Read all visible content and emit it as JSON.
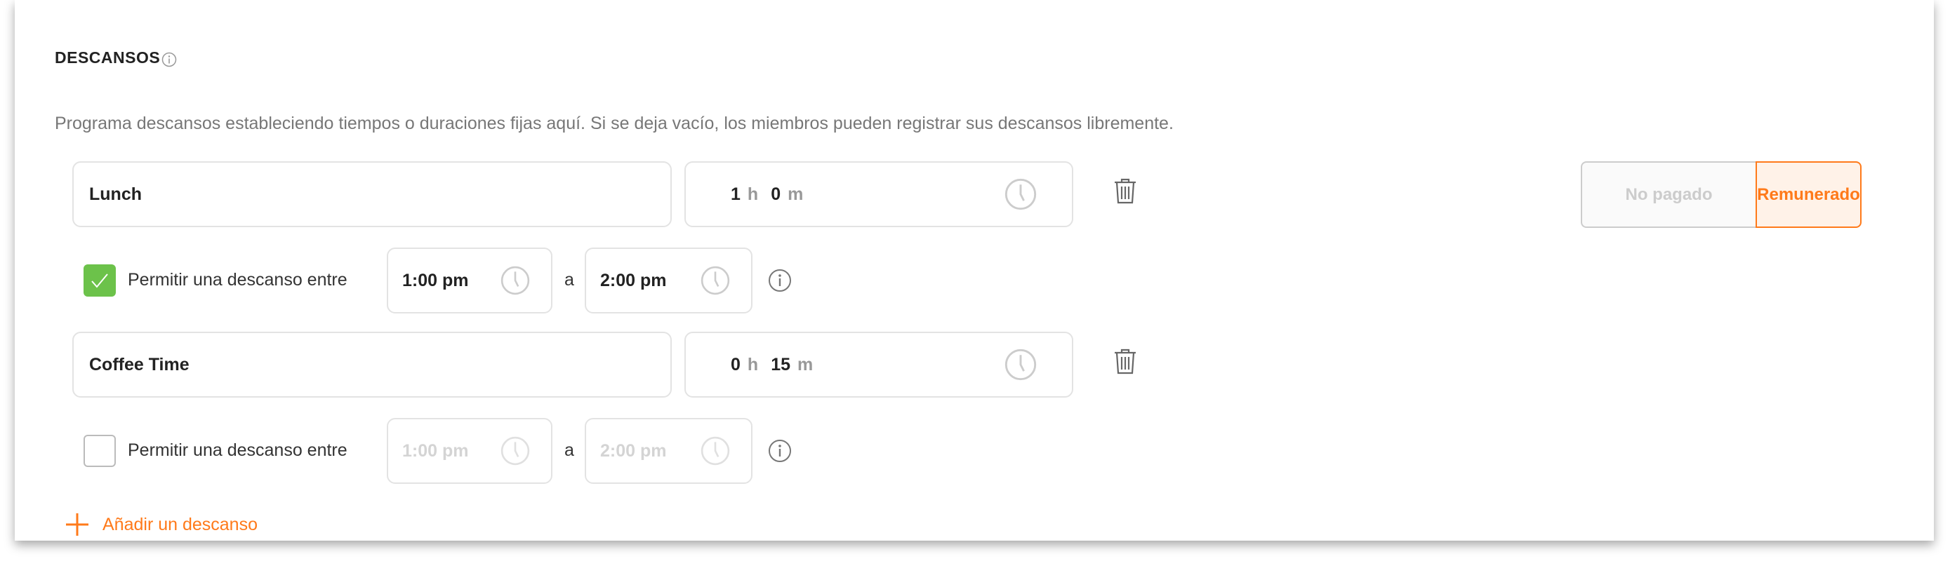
{
  "section": {
    "title": "DESCANSOS",
    "description": "Programa descansos estableciendo tiempos o duraciones fijas aquí. Si se deja vacío, los miembros pueden registrar sus descansos libremente."
  },
  "breaks": [
    {
      "name": "Lunch",
      "hours": "1",
      "minutes": "0",
      "hours_unit": "h",
      "minutes_unit": "m",
      "window_enabled": true,
      "window_label": "Permitir una descanso entre",
      "start": "1:00 pm",
      "separator": "a",
      "end": "2:00 pm"
    },
    {
      "name": "Coffee Time",
      "hours": "0",
      "minutes": "15",
      "hours_unit": "h",
      "minutes_unit": "m",
      "window_enabled": false,
      "window_label": "Permitir una descanso entre",
      "start": "1:00 pm",
      "separator": "a",
      "end": "2:00 pm"
    }
  ],
  "pay_toggle": {
    "options": [
      "No pagado",
      "Remunerado"
    ],
    "selected": "Remunerado"
  },
  "add_label": "Añadir un descanso",
  "colors": {
    "accent": "#ff7a1a",
    "check": "#6cc24a"
  }
}
